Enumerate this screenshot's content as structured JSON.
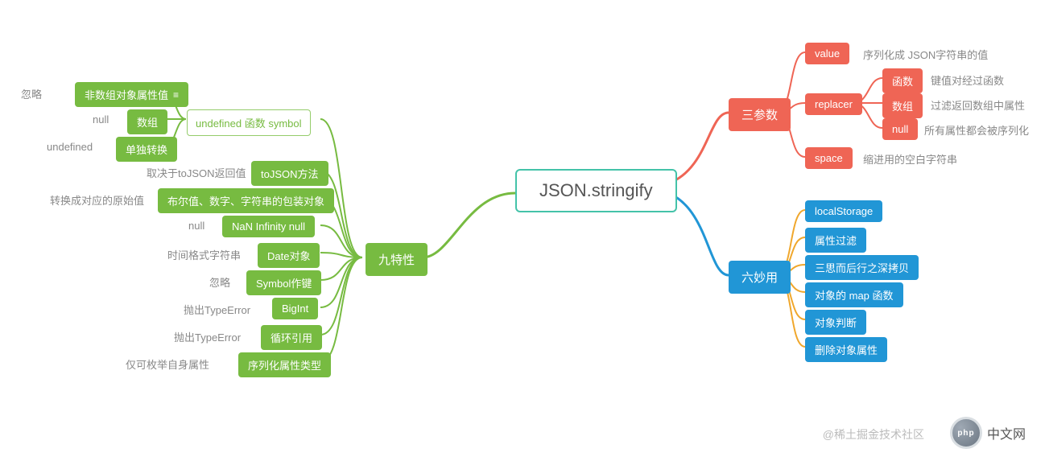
{
  "central": "JSON.stringify",
  "mains": {
    "green": "九特性",
    "red": "三参数",
    "blue": "六妙用"
  },
  "green": {
    "undef_symbol": "undefined 函数 symbol",
    "undef_children": {
      "c1_pill": "非数组对象属性值",
      "c1_txt": "忽略",
      "c2_pill": "数组",
      "c2_txt": "null",
      "c3_pill": "单独转换",
      "c3_txt": "undefined"
    },
    "row2_pill": "toJSON方法",
    "row2_txt": "取决于toJSON返回值",
    "row3_pill": "布尔值、数字、字符串的包装对象",
    "row3_txt": "转换成对应的原始值",
    "row4_pill": "NaN Infinity null",
    "row4_txt": "null",
    "row5_pill": "Date对象",
    "row5_txt": "时间格式字符串",
    "row6_pill": "Symbol作键",
    "row6_txt": "忽略",
    "row7_pill": "BigInt",
    "row7_txt": "抛出TypeError",
    "row8_pill": "循环引用",
    "row8_txt": "抛出TypeError",
    "row9_pill": "序列化属性类型",
    "row9_txt": "仅可枚举自身属性"
  },
  "red": {
    "p1_pill": "value",
    "p1_txt": "序列化成 JSON字符串的值",
    "p2_pill": "replacer",
    "p2_sub": {
      "r1_pill": "函数",
      "r1_txt": "键值对经过函数",
      "r2_pill": "数组",
      "r2_txt": "过滤返回数组中属性",
      "r3_pill": "null",
      "r3_txt": "所有属性都会被序列化"
    },
    "p3_pill": "space",
    "p3_txt": "缩进用的空白字符串"
  },
  "blue": {
    "b1": "localStorage",
    "b2": "属性过滤",
    "b3": "三思而后行之深拷贝",
    "b4": "对象的 map 函数",
    "b5": "对象判断",
    "b6": "删除对象属性"
  },
  "watermark": "@稀土掘金技术社区",
  "logo_text": "php",
  "logo_cn": "中文网"
}
